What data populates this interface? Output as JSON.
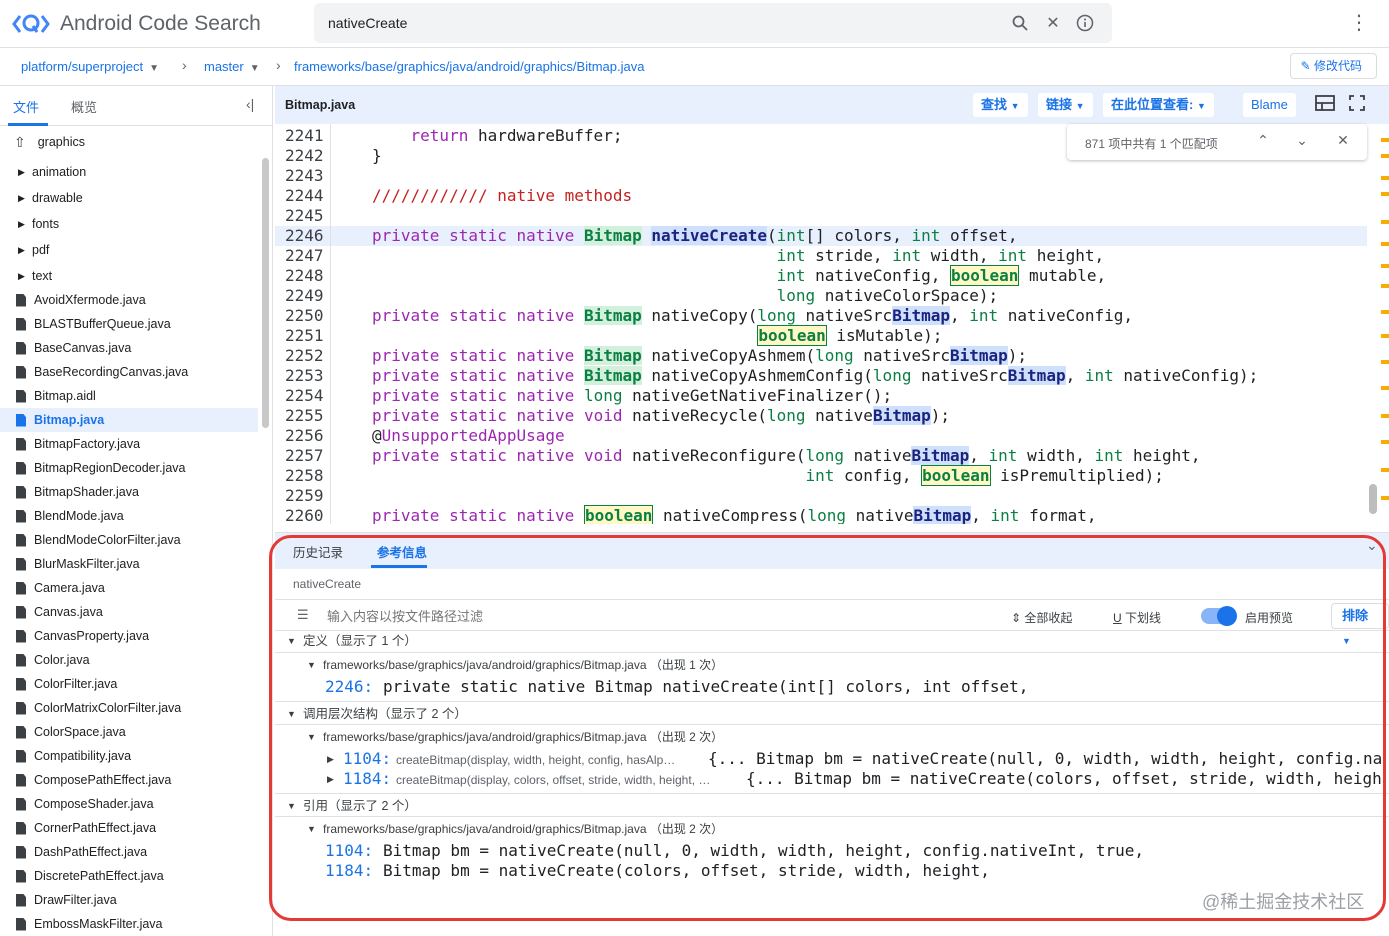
{
  "app": {
    "title": "Android Code Search"
  },
  "search": {
    "value": "nativeCreate"
  },
  "breadcrumb": {
    "project": "platform/superproject",
    "branch": "master",
    "path": "frameworks/base/graphics/java/android/graphics/Bitmap.java",
    "edit_label": "修改代码"
  },
  "sidebar": {
    "tabs": [
      "文件",
      "概览"
    ],
    "parent": "graphics",
    "folders": [
      "animation",
      "drawable",
      "fonts",
      "pdf",
      "text"
    ],
    "files": [
      "AvoidXfermode.java",
      "BLASTBufferQueue.java",
      "BaseCanvas.java",
      "BaseRecordingCanvas.java",
      "Bitmap.aidl",
      "Bitmap.java",
      "BitmapFactory.java",
      "BitmapRegionDecoder.java",
      "BitmapShader.java",
      "BlendMode.java",
      "BlendModeColorFilter.java",
      "BlurMaskFilter.java",
      "Camera.java",
      "Canvas.java",
      "CanvasProperty.java",
      "Color.java",
      "ColorFilter.java",
      "ColorMatrixColorFilter.java",
      "ColorSpace.java",
      "Compatibility.java",
      "ComposePathEffect.java",
      "ComposeShader.java",
      "CornerPathEffect.java",
      "DashPathEffect.java",
      "DiscretePathEffect.java",
      "DrawFilter.java",
      "EmbossMaskFilter.java"
    ],
    "selected": "Bitmap.java"
  },
  "file_header": {
    "name": "Bitmap.java",
    "find": "查找",
    "links": "链接",
    "view_in": "在此位置查看:",
    "blame": "Blame"
  },
  "find_bar": {
    "count": "871 项中共有 1 个匹配项"
  },
  "code": {
    "highlight_line": "2246",
    "lines": [
      {
        "n": "2241"
      },
      {
        "n": "2242"
      },
      {
        "n": "2243"
      },
      {
        "n": "2244"
      },
      {
        "n": "2245"
      },
      {
        "n": "2246"
      },
      {
        "n": "2247"
      },
      {
        "n": "2248"
      },
      {
        "n": "2249"
      },
      {
        "n": "2250"
      },
      {
        "n": "2251"
      },
      {
        "n": "2252"
      },
      {
        "n": "2253"
      },
      {
        "n": "2254"
      },
      {
        "n": "2255"
      },
      {
        "n": "2256"
      },
      {
        "n": "2257"
      },
      {
        "n": "2258"
      },
      {
        "n": "2259"
      },
      {
        "n": "2260"
      }
    ]
  },
  "panel": {
    "tabs": [
      "历史记录",
      "参考信息"
    ],
    "query": "nativeCreate",
    "filter_placeholder": "输入内容以按文件路径过滤",
    "collapse_all": "全部收起",
    "underline": "下划线",
    "preview": "启用预览",
    "exclude": "排除",
    "sections": {
      "definition": {
        "header": "定义（显示了 1 个）",
        "path": "frameworks/base/graphics/java/android/graphics/Bitmap.java （出现 1 次）",
        "num": "2246:",
        "code": "private static native Bitmap nativeCreate(int[] colors, int offset,"
      },
      "hierarchy": {
        "header": "调用层次结构（显示了 2 个）",
        "path": "frameworks/base/graphics/java/android/graphics/Bitmap.java （出现 2 次）",
        "rows": [
          {
            "num": "1104:",
            "fn": "createBitmap(display, width, height, config, hasAlp…",
            "code": "{... Bitmap bm = nativeCreate(null, 0, width, width, height, config.na"
          },
          {
            "num": "1184:",
            "fn": "createBitmap(display, colors, offset, stride, width, height, …",
            "code": "{... Bitmap bm = nativeCreate(colors, offset, stride, width, heigh"
          }
        ]
      },
      "references": {
        "header": "引用（显示了 2 个）",
        "path": "frameworks/base/graphics/java/android/graphics/Bitmap.java （出现 2 次）",
        "rows": [
          {
            "num": "1104:",
            "code": "Bitmap bm = nativeCreate(null, 0, width, width, height, config.nativeInt, true,"
          },
          {
            "num": "1184:",
            "code": "Bitmap bm = nativeCreate(colors, offset, stride, width, height,"
          }
        ]
      }
    }
  },
  "watermark": "@稀土掘金技术社区",
  "colors": {
    "accent": "#1a73e8",
    "annotation": "#e53935",
    "keyword": "#9c27b0",
    "type": "#0b8043"
  }
}
